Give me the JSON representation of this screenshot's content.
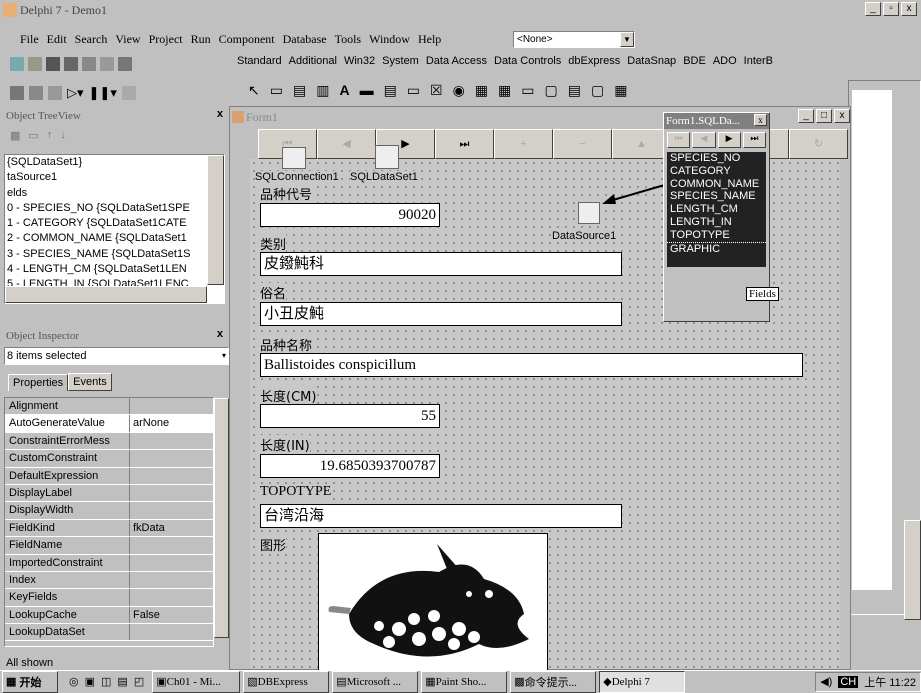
{
  "app": {
    "title": "Delphi 7 - Demo1"
  },
  "menu": [
    "File",
    "Edit",
    "Search",
    "View",
    "Project",
    "Run",
    "Component",
    "Database",
    "Tools",
    "Window",
    "Help"
  ],
  "config_combo": "<None>",
  "palette_tabs": [
    "Standard",
    "Additional",
    "Win32",
    "System",
    "Data Access",
    "Data Controls",
    "dbExpress",
    "DataSnap",
    "BDE",
    "ADO",
    "InterB"
  ],
  "treeview": {
    "title": "Object TreeView",
    "items": [
      "{SQLDataSet1}",
      "taSource1",
      "elds",
      "0 - SPECIES_NO {SQLDataSet1SPE",
      "1 - CATEGORY {SQLDataSet1CATE",
      "2 - COMMON_NAME {SQLDataSet1",
      "3 - SPECIES_NAME {SQLDataSet1S",
      "4 - LENGTH_CM {SQLDataSet1LEN",
      "5 - LENGTH_IN {SQLDataSet1LENC"
    ]
  },
  "inspector": {
    "title": "Object Inspector",
    "selection": "8 items selected",
    "tab_properties": "Properties",
    "tab_events": "Events",
    "rows": [
      [
        "Alignment",
        ""
      ],
      [
        "AutoGenerateValue",
        "arNone"
      ],
      [
        "ConstraintErrorMess",
        ""
      ],
      [
        "CustomConstraint",
        ""
      ],
      [
        "DefaultExpression",
        ""
      ],
      [
        "DisplayLabel",
        ""
      ],
      [
        "DisplayWidth",
        ""
      ],
      [
        "FieldKind",
        "fkData"
      ],
      [
        "FieldName",
        ""
      ],
      [
        "ImportedConstraint",
        ""
      ],
      [
        "Index",
        ""
      ],
      [
        "KeyFields",
        ""
      ],
      [
        "LookupCache",
        "False"
      ],
      [
        "LookupDataSet",
        ""
      ]
    ],
    "status": "All shown"
  },
  "form": {
    "title": "Form1",
    "comp_conn": "SQLConnection1",
    "comp_dataset": "SQLDataSet1",
    "comp_source": "DataSource1",
    "fields": [
      {
        "label": "品种代号",
        "value": "90020"
      },
      {
        "label": "类别",
        "value": "皮鏺魨科"
      },
      {
        "label": "俗名",
        "value": "小丑皮魨"
      },
      {
        "label": "品种名称",
        "value": "Ballistoides conspicillum"
      },
      {
        "label": "长度(CM)",
        "value": "55"
      },
      {
        "label": "长度(IN)",
        "value": "19.6850393700787"
      },
      {
        "label": "TOPOTYPE",
        "value": "台湾沿海"
      },
      {
        "label": "图形",
        "value": ""
      }
    ]
  },
  "fields_editor": {
    "title": "Form1.SQLDa...",
    "items": [
      "SPECIES_NO",
      "CATEGORY",
      "COMMON_NAME",
      "SPECIES_NAME",
      "LENGTH_CM",
      "LENGTH_IN",
      "TOPOTYPE",
      "GRAPHIC"
    ],
    "tooltip": "Fields"
  },
  "taskbar": {
    "start": "开始",
    "tasks": [
      "Ch01 - Mi...",
      "DBExpress",
      "Microsoft ...",
      "Paint Sho...",
      "命令提示...",
      "Delphi 7"
    ],
    "ime": "CH",
    "clock": "上午 11:22"
  }
}
